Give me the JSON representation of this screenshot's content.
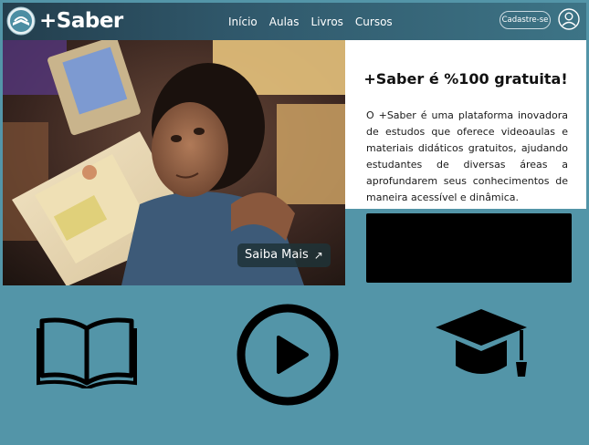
{
  "header": {
    "brand": "+Saber",
    "nav": [
      "Início",
      "Aulas",
      "Livros",
      "Cursos"
    ],
    "signup_label": "Cadastre-se"
  },
  "hero": {
    "cta_label": "Saiba Mais",
    "cta_icon": "arrow-up-right-icon"
  },
  "info": {
    "title": "+Saber é %100 gratuita!",
    "description": "O +Saber é uma plataforma inovadora de estudos que oferece videoaulas e materiais didáticos gratuitos, ajudando estudantes de diversas áreas a aprofundarem seus conhecimentos de maneira acessível e dinâmica."
  },
  "features": {
    "icons": [
      "book-icon",
      "play-icon",
      "graduation-cap-icon"
    ]
  },
  "colors": {
    "header_dark": "#233e4d",
    "teal": "#5395a8",
    "video_placeholder": "#000000"
  }
}
